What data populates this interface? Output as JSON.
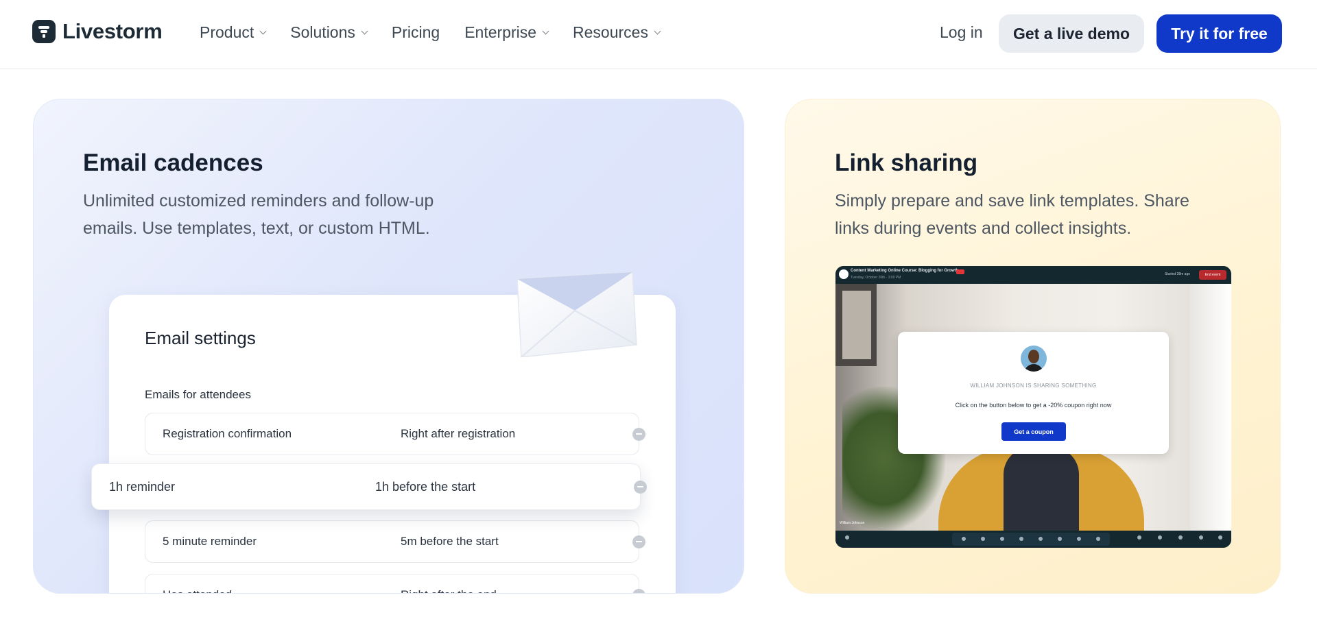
{
  "nav": {
    "brand": "Livestorm",
    "menu": [
      {
        "label": "Product",
        "has_dropdown": true
      },
      {
        "label": "Solutions",
        "has_dropdown": true
      },
      {
        "label": "Pricing",
        "has_dropdown": false
      },
      {
        "label": "Enterprise",
        "has_dropdown": true
      },
      {
        "label": "Resources",
        "has_dropdown": true
      }
    ],
    "login": "Log in",
    "demo_button": "Get a live demo",
    "try_button": "Try it for free"
  },
  "email_card": {
    "title": "Email cadences",
    "description_line1": "Unlimited customized reminders and follow-up",
    "description_line2": "emails. Use templates, text, or custom HTML.",
    "panel_title": "Email settings",
    "section_label": "Emails for attendees",
    "rows": [
      {
        "name": "Registration confirmation",
        "timing": "Right after registration"
      },
      {
        "name": "1h reminder",
        "timing": "1h before the start"
      },
      {
        "name": "5 minute reminder",
        "timing": "5m before the start"
      },
      {
        "name": "Has attended",
        "timing": "Right after the end"
      }
    ]
  },
  "link_card": {
    "title": "Link sharing",
    "description_line1": "Simply prepare and save link templates. Share",
    "description_line2": "links during events and collect insights.",
    "video": {
      "event_title": "Content Marketing Online Course: Blogging for Growth",
      "event_date": "Tuesday, October 26th · 3:00 PM",
      "started_text": "Started 38m ago",
      "end_button": "End event",
      "speaker_name": "William Johnson",
      "popup_sharing": "WILLIAM JOHNSON IS SHARING SOMETHING",
      "popup_message": "Click on the button below to get a -20% coupon right now",
      "popup_button": "Get a coupon"
    }
  },
  "colors": {
    "primary": "#1038c9",
    "email_card_bg": "#dfe6fb",
    "link_card_bg": "#fff3d3",
    "text_dark": "#142030"
  }
}
